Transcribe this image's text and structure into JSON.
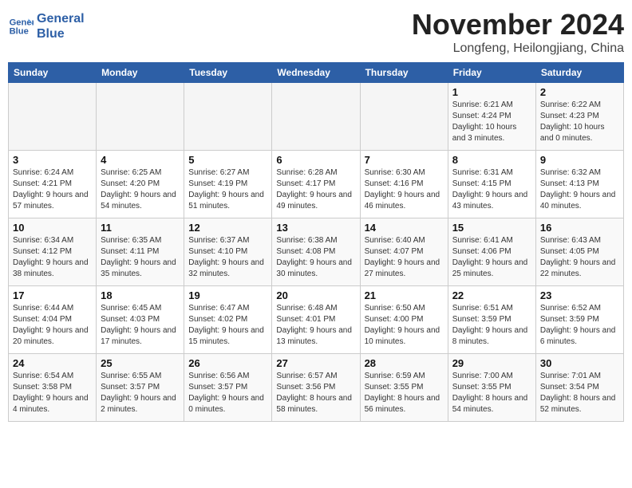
{
  "logo": {
    "line1": "General",
    "line2": "Blue"
  },
  "title": "November 2024",
  "subtitle": "Longfeng, Heilongjiang, China",
  "headers": [
    "Sunday",
    "Monday",
    "Tuesday",
    "Wednesday",
    "Thursday",
    "Friday",
    "Saturday"
  ],
  "weeks": [
    [
      {
        "day": "",
        "info": "",
        "empty": true
      },
      {
        "day": "",
        "info": "",
        "empty": true
      },
      {
        "day": "",
        "info": "",
        "empty": true
      },
      {
        "day": "",
        "info": "",
        "empty": true
      },
      {
        "day": "",
        "info": "",
        "empty": true
      },
      {
        "day": "1",
        "info": "Sunrise: 6:21 AM\nSunset: 4:24 PM\nDaylight: 10 hours\nand 3 minutes."
      },
      {
        "day": "2",
        "info": "Sunrise: 6:22 AM\nSunset: 4:23 PM\nDaylight: 10 hours\nand 0 minutes."
      }
    ],
    [
      {
        "day": "3",
        "info": "Sunrise: 6:24 AM\nSunset: 4:21 PM\nDaylight: 9 hours\nand 57 minutes."
      },
      {
        "day": "4",
        "info": "Sunrise: 6:25 AM\nSunset: 4:20 PM\nDaylight: 9 hours\nand 54 minutes."
      },
      {
        "day": "5",
        "info": "Sunrise: 6:27 AM\nSunset: 4:19 PM\nDaylight: 9 hours\nand 51 minutes."
      },
      {
        "day": "6",
        "info": "Sunrise: 6:28 AM\nSunset: 4:17 PM\nDaylight: 9 hours\nand 49 minutes."
      },
      {
        "day": "7",
        "info": "Sunrise: 6:30 AM\nSunset: 4:16 PM\nDaylight: 9 hours\nand 46 minutes."
      },
      {
        "day": "8",
        "info": "Sunrise: 6:31 AM\nSunset: 4:15 PM\nDaylight: 9 hours\nand 43 minutes."
      },
      {
        "day": "9",
        "info": "Sunrise: 6:32 AM\nSunset: 4:13 PM\nDaylight: 9 hours\nand 40 minutes."
      }
    ],
    [
      {
        "day": "10",
        "info": "Sunrise: 6:34 AM\nSunset: 4:12 PM\nDaylight: 9 hours\nand 38 minutes."
      },
      {
        "day": "11",
        "info": "Sunrise: 6:35 AM\nSunset: 4:11 PM\nDaylight: 9 hours\nand 35 minutes."
      },
      {
        "day": "12",
        "info": "Sunrise: 6:37 AM\nSunset: 4:10 PM\nDaylight: 9 hours\nand 32 minutes."
      },
      {
        "day": "13",
        "info": "Sunrise: 6:38 AM\nSunset: 4:08 PM\nDaylight: 9 hours\nand 30 minutes."
      },
      {
        "day": "14",
        "info": "Sunrise: 6:40 AM\nSunset: 4:07 PM\nDaylight: 9 hours\nand 27 minutes."
      },
      {
        "day": "15",
        "info": "Sunrise: 6:41 AM\nSunset: 4:06 PM\nDaylight: 9 hours\nand 25 minutes."
      },
      {
        "day": "16",
        "info": "Sunrise: 6:43 AM\nSunset: 4:05 PM\nDaylight: 9 hours\nand 22 minutes."
      }
    ],
    [
      {
        "day": "17",
        "info": "Sunrise: 6:44 AM\nSunset: 4:04 PM\nDaylight: 9 hours\nand 20 minutes."
      },
      {
        "day": "18",
        "info": "Sunrise: 6:45 AM\nSunset: 4:03 PM\nDaylight: 9 hours\nand 17 minutes."
      },
      {
        "day": "19",
        "info": "Sunrise: 6:47 AM\nSunset: 4:02 PM\nDaylight: 9 hours\nand 15 minutes."
      },
      {
        "day": "20",
        "info": "Sunrise: 6:48 AM\nSunset: 4:01 PM\nDaylight: 9 hours\nand 13 minutes."
      },
      {
        "day": "21",
        "info": "Sunrise: 6:50 AM\nSunset: 4:00 PM\nDaylight: 9 hours\nand 10 minutes."
      },
      {
        "day": "22",
        "info": "Sunrise: 6:51 AM\nSunset: 3:59 PM\nDaylight: 9 hours\nand 8 minutes."
      },
      {
        "day": "23",
        "info": "Sunrise: 6:52 AM\nSunset: 3:59 PM\nDaylight: 9 hours\nand 6 minutes."
      }
    ],
    [
      {
        "day": "24",
        "info": "Sunrise: 6:54 AM\nSunset: 3:58 PM\nDaylight: 9 hours\nand 4 minutes."
      },
      {
        "day": "25",
        "info": "Sunrise: 6:55 AM\nSunset: 3:57 PM\nDaylight: 9 hours\nand 2 minutes."
      },
      {
        "day": "26",
        "info": "Sunrise: 6:56 AM\nSunset: 3:57 PM\nDaylight: 9 hours\nand 0 minutes."
      },
      {
        "day": "27",
        "info": "Sunrise: 6:57 AM\nSunset: 3:56 PM\nDaylight: 8 hours\nand 58 minutes."
      },
      {
        "day": "28",
        "info": "Sunrise: 6:59 AM\nSunset: 3:55 PM\nDaylight: 8 hours\nand 56 minutes."
      },
      {
        "day": "29",
        "info": "Sunrise: 7:00 AM\nSunset: 3:55 PM\nDaylight: 8 hours\nand 54 minutes."
      },
      {
        "day": "30",
        "info": "Sunrise: 7:01 AM\nSunset: 3:54 PM\nDaylight: 8 hours\nand 52 minutes."
      }
    ]
  ]
}
